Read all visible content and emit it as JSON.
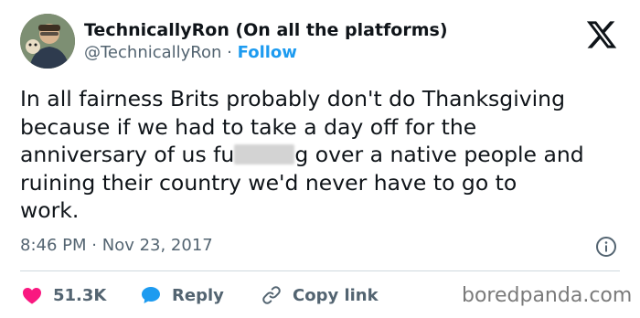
{
  "author": {
    "display_name": "TechnicallyRon (On all the platforms)",
    "handle": "@TechnicallyRon",
    "separator": "·",
    "follow_label": "Follow"
  },
  "tweet": {
    "lines": [
      "In all fairness Brits probably don't do Thanksgiving",
      "because if we had to take a day off for the",
      "g over a native people and",
      "ruining their country we'd never have to go to",
      "work."
    ],
    "line3_prefix": "anniversary of us fu",
    "time": "8:46 PM",
    "date_separator": "·",
    "date": "Nov 23, 2017"
  },
  "actions": {
    "likes": "51.3K",
    "reply_label": "Reply",
    "copy_label": "Copy link"
  },
  "watermark": "boredpanda.com",
  "colors": {
    "text": "#0f1419",
    "secondary": "#536471",
    "accent": "#1d9bf0",
    "like": "#f91880",
    "divider": "#cfd9de"
  },
  "icons": {
    "brand": "x-logo-icon",
    "info": "info-icon",
    "like": "heart-icon",
    "reply": "speech-bubble-icon",
    "copy": "link-icon"
  }
}
